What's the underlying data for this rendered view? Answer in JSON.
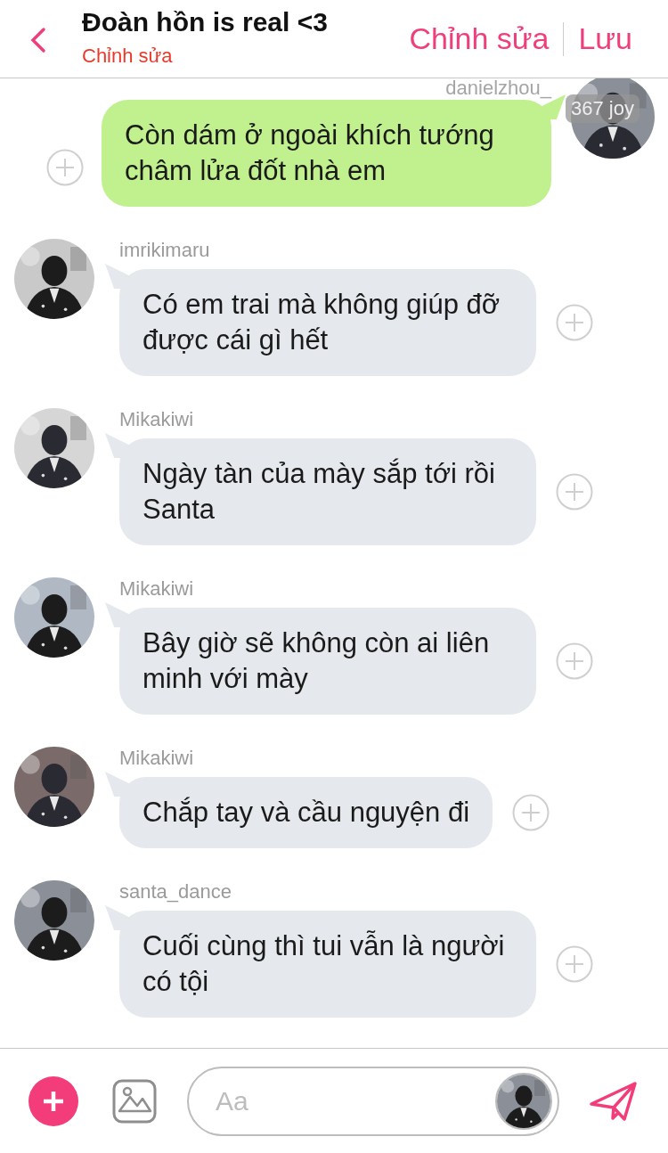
{
  "header": {
    "title": "Đoàn hồn is real <3",
    "subtitle": "Chỉnh sửa",
    "actions": [
      "Chỉnh sửa",
      "Lưu"
    ]
  },
  "messages": [
    {
      "kind": "outgoing",
      "sender": "danielzhou_",
      "badge": "367 joy",
      "text": "Còn dám ở ngoài khích tướng châm lửa đốt nhà em"
    },
    {
      "kind": "incoming",
      "sender": "imrikimaru",
      "text": "Có em trai mà không giúp đỡ được cái gì hết"
    },
    {
      "kind": "incoming",
      "sender": "Mikakiwi",
      "text": "Ngày tàn của mày sắp tới rồi Santa"
    },
    {
      "kind": "incoming",
      "sender": "Mikakiwi",
      "text": "Bây giờ sẽ không còn ai liên minh với mày"
    },
    {
      "kind": "incoming",
      "sender": "Mikakiwi",
      "text": "Chắp tay và cầu nguyện đi"
    },
    {
      "kind": "incoming",
      "sender": "santa_dance",
      "text": "Cuối cùng thì tui vẫn là người có tội"
    }
  ],
  "composer": {
    "placeholder": "Aa"
  }
}
